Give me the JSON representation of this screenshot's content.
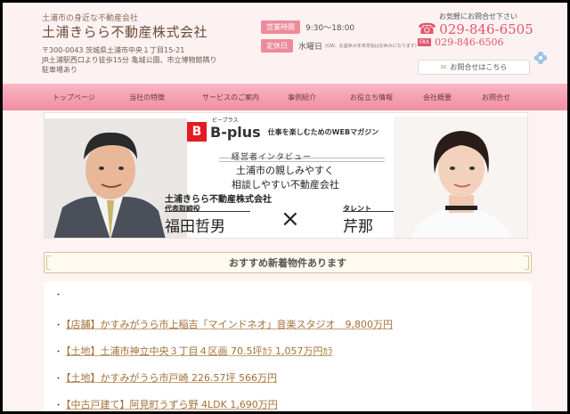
{
  "header": {
    "tagline": "土浦市の身近な不動産会社",
    "company_name": "土浦きらら不動産株式会社",
    "address_lines": [
      "〒300-0043 茨城県土浦市中央１丁目15-21",
      "JR土浦駅西口より徒歩15分 亀城公園、市立博物館隣り",
      "駐車場あり"
    ],
    "hours_label": "営業時間",
    "hours_value": "9:30～18:00",
    "holiday_label": "定休日",
    "holiday_value": "水曜日",
    "holiday_note": "(GW、お盆休み年末年始はお休みになります)",
    "contact_lead": "お気軽にお問合せ下さい",
    "tel": "029-846-6505",
    "fax_label": "FAX",
    "fax": "029-846-6506",
    "contact_button": "お問合せはこちら",
    "accent": "#e2566e"
  },
  "nav": {
    "items": [
      "トップページ",
      "当社の特徴",
      "サービスのご案内",
      "事例紹介",
      "お役立ち情報",
      "会社概要",
      "お問合せ"
    ]
  },
  "banner": {
    "logo_letter": "B",
    "logo_kana": "ビープラス",
    "logo_text": "B-plus",
    "magazine": "仕事を楽しむためのWEBマガジン",
    "interview_label": "経営者インタビュー",
    "catch_line1": "土浦市の親しみやすく",
    "catch_line2": "相談しやすい不動産会社",
    "company": "土浦きらら不動産株式会社",
    "role1": "代表取締役",
    "name1": "福田哲男",
    "cross": "×",
    "role2": "タレント",
    "name2": "芹那"
  },
  "section": {
    "title": "おすすめ新着物件あります"
  },
  "listings": [
    "【店舗】かすみがうら市上稲吉「マインドネオ」音楽スタジオ　9,800万円",
    "【土地】土浦市神立中央３丁目４区画 70.5坪ｶﾗ 1,057万円ｶﾗ",
    "【土地】かすみがうら市戸崎 226.57坪 566万円",
    "【中古戸建て】阿見町うずら野 4LDK 1,690万円"
  ]
}
